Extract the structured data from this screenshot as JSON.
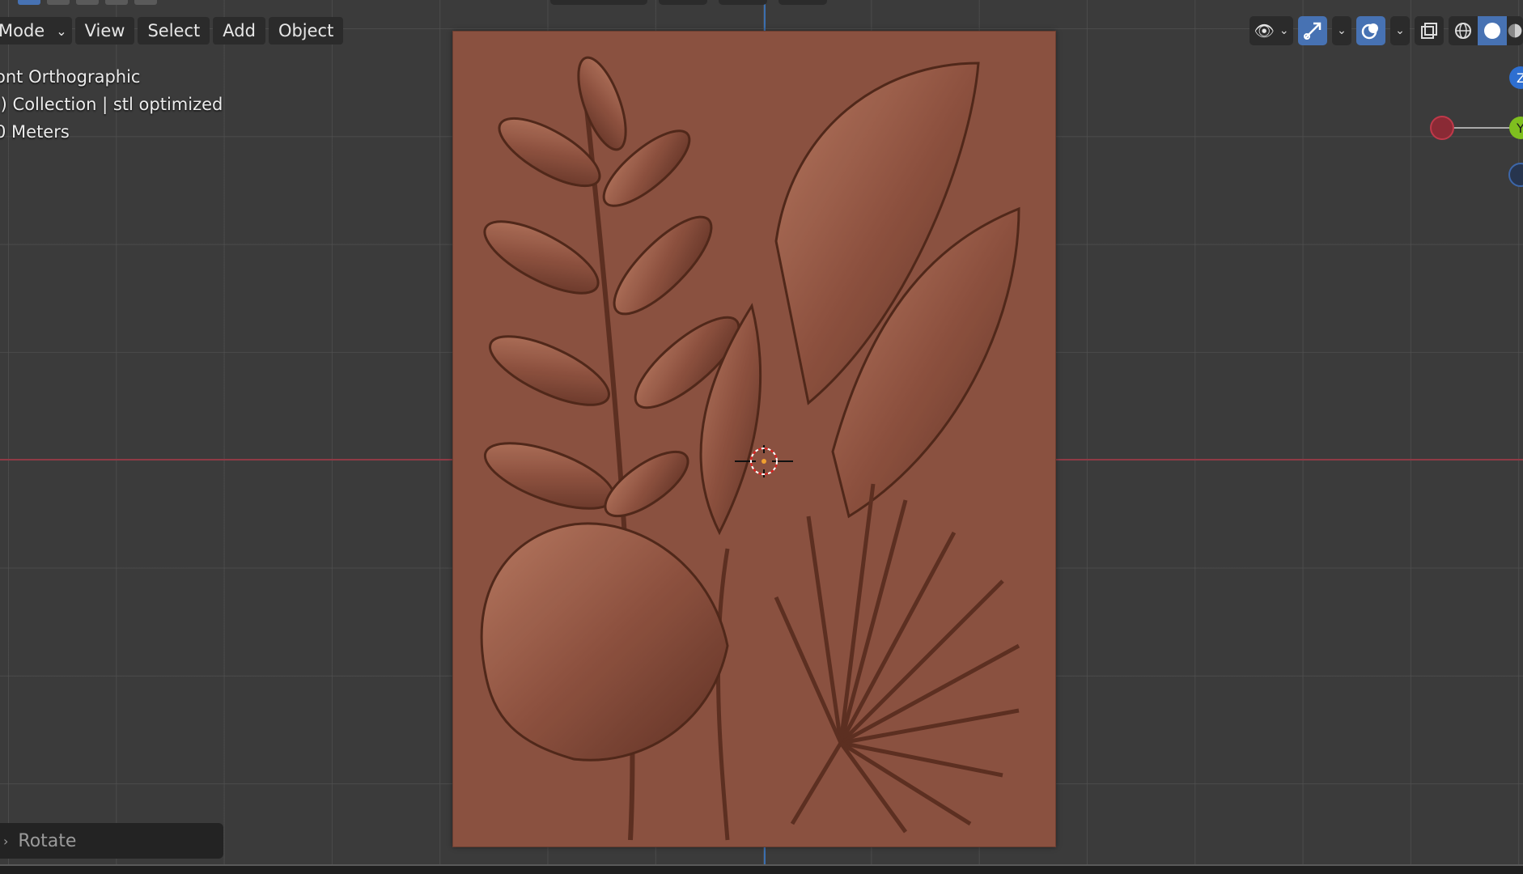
{
  "header": {
    "mode_label": "Mode",
    "menu": [
      "View",
      "Select",
      "Add",
      "Object"
    ]
  },
  "overlay": {
    "view_name": "ont Orthographic",
    "collection": ".) Collection | stl optimized",
    "units": "0 Meters"
  },
  "operator_panel": {
    "label": "Rotate"
  },
  "gizmo": {
    "z_label": "Z",
    "y_label": "Y"
  },
  "colors": {
    "relief": "#8a5140",
    "axis_x": "#8f3a45",
    "axis_y": "#3b6fb0",
    "accent": "#4772b3"
  },
  "icons": [
    "chevron-down-icon",
    "eye-icon",
    "gizmo-icon",
    "overlay-icon",
    "xray-icon",
    "wireframe-icon",
    "solid-icon",
    "material-icon",
    "3d-cursor-icon"
  ]
}
